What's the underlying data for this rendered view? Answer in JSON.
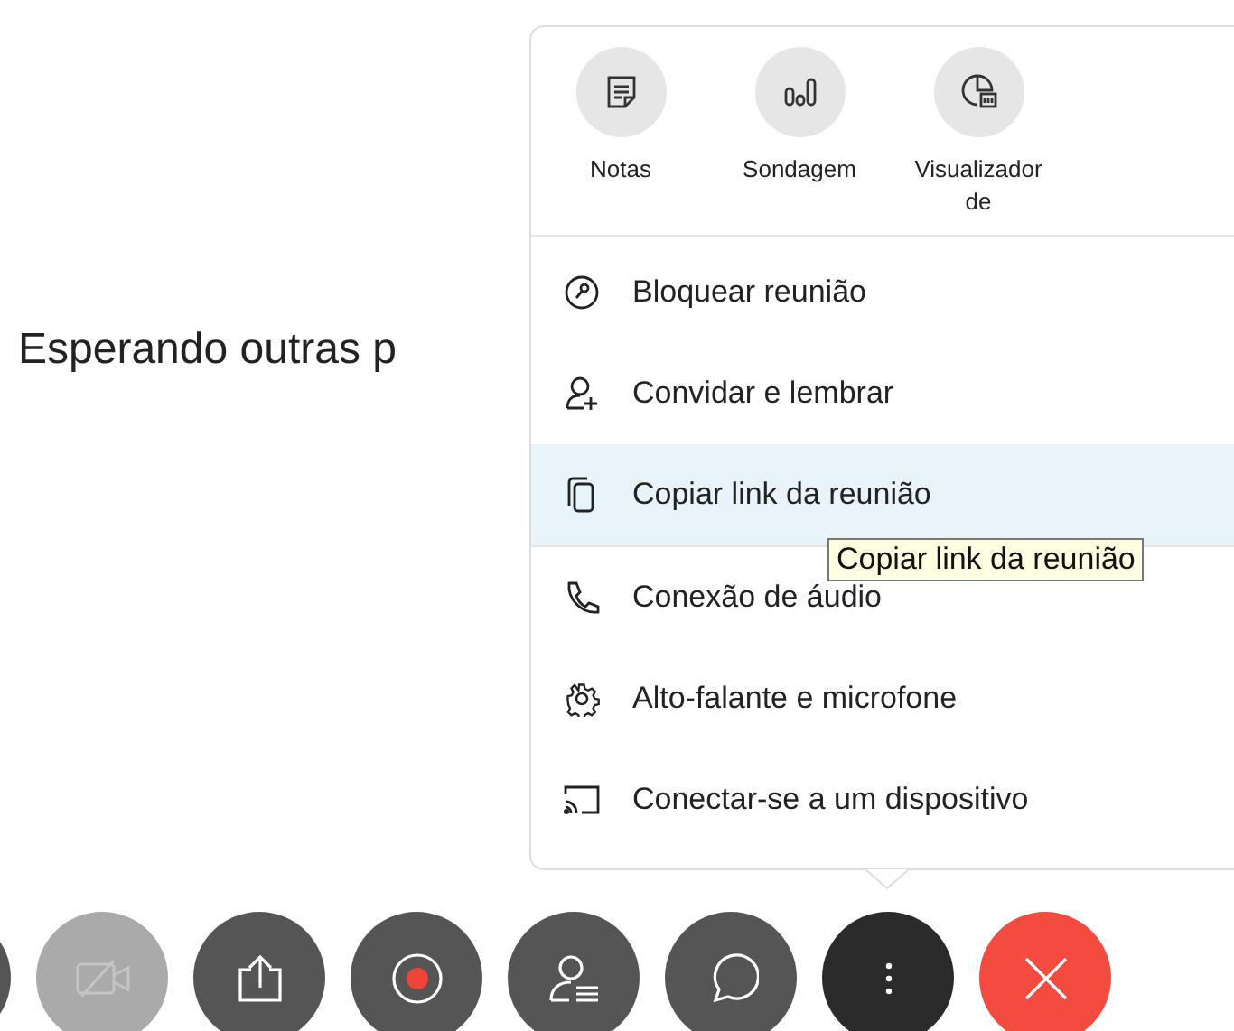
{
  "status_text": "Esperando outras p",
  "menu": {
    "apps": [
      {
        "kind": "notes",
        "label": "Notas"
      },
      {
        "kind": "poll",
        "label": "Sondagem"
      },
      {
        "kind": "viewer",
        "label": "Visualizador de"
      }
    ],
    "items": [
      {
        "kind": "lock",
        "label": "Bloquear reunião",
        "selected": false
      },
      {
        "kind": "invite",
        "label": "Convidar e lembrar",
        "selected": false
      },
      {
        "kind": "copy",
        "label": "Copiar link da reunião",
        "selected": true
      },
      {
        "kind": "phone",
        "label": "Conexão de áudio",
        "selected": false
      },
      {
        "kind": "gear",
        "label": "Alto-falante e microfone",
        "selected": false
      },
      {
        "kind": "cast",
        "label": "Conectar-se a um dispositivo",
        "selected": false
      }
    ],
    "tooltip": "Copiar link da reunião"
  },
  "toolbar": [
    {
      "kind": "partial",
      "disabled": false,
      "selected": false
    },
    {
      "kind": "camera",
      "disabled": true,
      "selected": false
    },
    {
      "kind": "share",
      "disabled": false,
      "selected": false
    },
    {
      "kind": "record",
      "disabled": false,
      "selected": false
    },
    {
      "kind": "participants",
      "disabled": false,
      "selected": false
    },
    {
      "kind": "chat",
      "disabled": false,
      "selected": false
    },
    {
      "kind": "more",
      "disabled": false,
      "selected": true
    },
    {
      "kind": "end",
      "disabled": false,
      "selected": false
    }
  ]
}
